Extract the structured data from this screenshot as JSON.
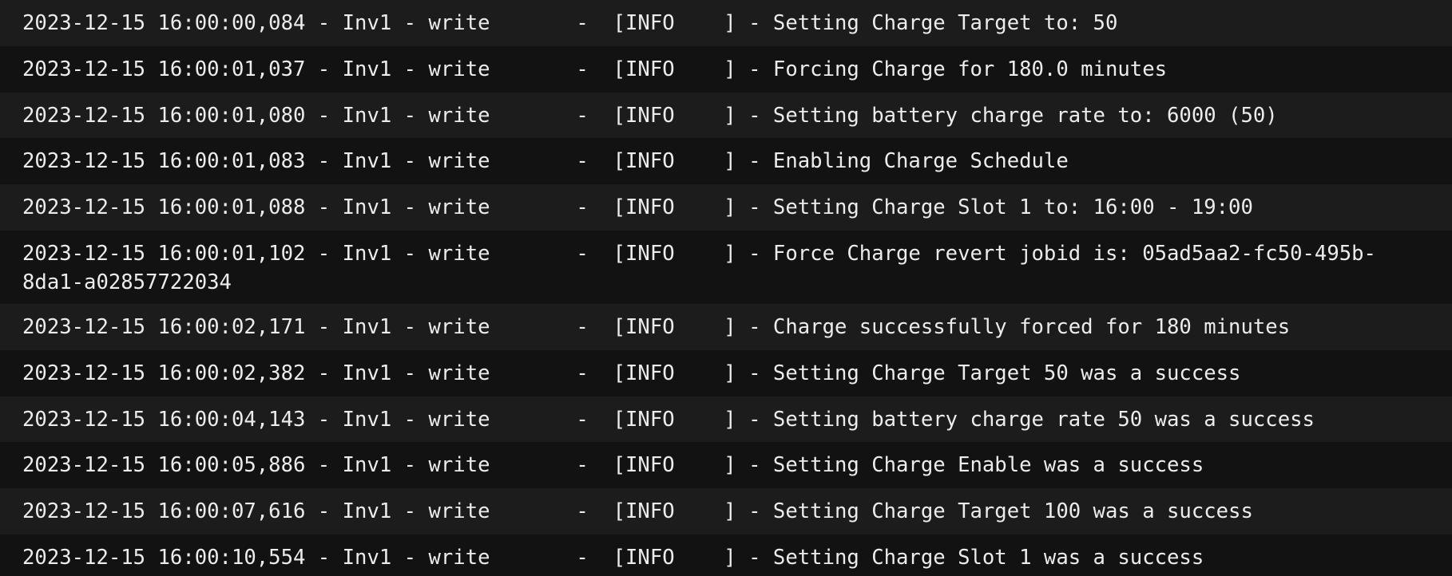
{
  "log": {
    "lines": [
      "2023-12-15 16:00:00,084 - Inv1 - write       -  [INFO    ] - Setting Charge Target to: 50",
      "2023-12-15 16:00:01,037 - Inv1 - write       -  [INFO    ] - Forcing Charge for 180.0 minutes",
      "2023-12-15 16:00:01,080 - Inv1 - write       -  [INFO    ] - Setting battery charge rate to: 6000 (50)",
      "2023-12-15 16:00:01,083 - Inv1 - write       -  [INFO    ] - Enabling Charge Schedule",
      "2023-12-15 16:00:01,088 - Inv1 - write       -  [INFO    ] - Setting Charge Slot 1 to: 16:00 - 19:00",
      "2023-12-15 16:00:01,102 - Inv1 - write       -  [INFO    ] - Force Charge revert jobid is: 05ad5aa2-fc50-495b-8da1-a02857722034",
      "2023-12-15 16:00:02,171 - Inv1 - write       -  [INFO    ] - Charge successfully forced for 180 minutes",
      "2023-12-15 16:00:02,382 - Inv1 - write       -  [INFO    ] - Setting Charge Target 50 was a success",
      "2023-12-15 16:00:04,143 - Inv1 - write       -  [INFO    ] - Setting battery charge rate 50 was a success",
      "2023-12-15 16:00:05,886 - Inv1 - write       -  [INFO    ] - Setting Charge Enable was a success",
      "2023-12-15 16:00:07,616 - Inv1 - write       -  [INFO    ] - Setting Charge Target 100 was a success",
      "2023-12-15 16:00:10,554 - Inv1 - write       -  [INFO    ] - Setting Charge Slot 1 was a success"
    ]
  }
}
